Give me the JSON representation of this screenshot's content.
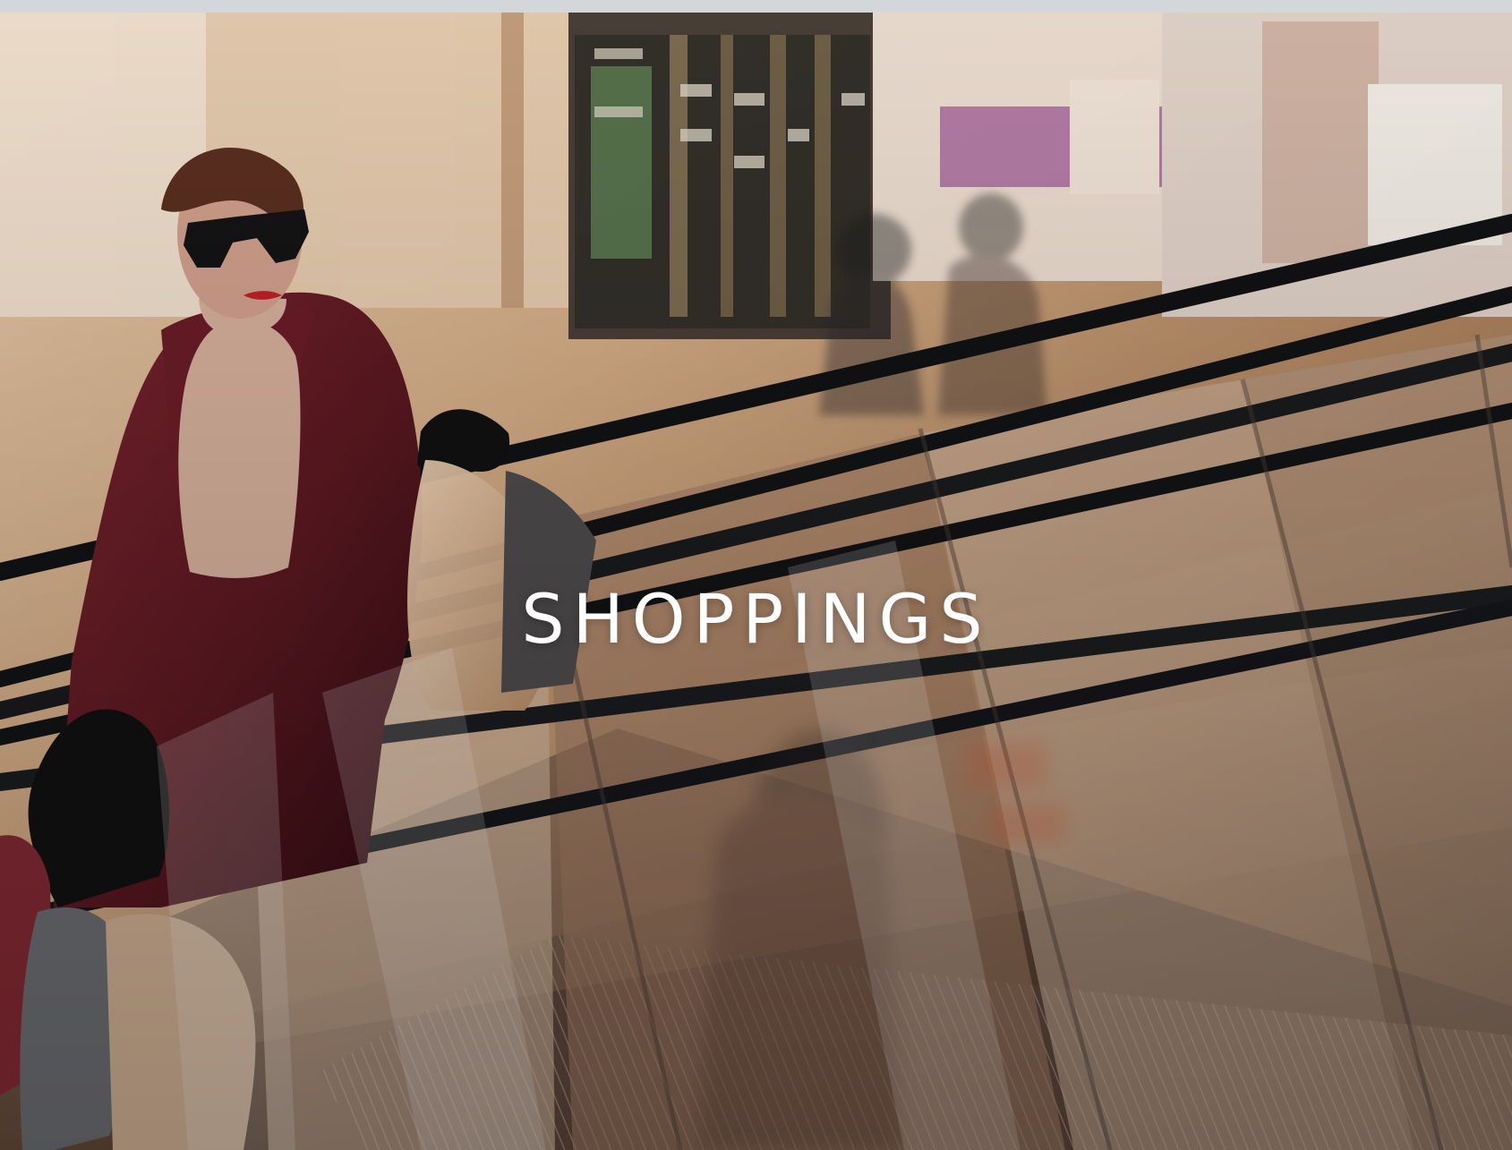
{
  "hero": {
    "title": "SHOPPINGS"
  },
  "colors": {
    "top_strip": "#d3d7da",
    "title_text": "#ffffff",
    "coat": "#5b1820",
    "handrail": "#141518",
    "mall_floor": "#d9b48f"
  }
}
